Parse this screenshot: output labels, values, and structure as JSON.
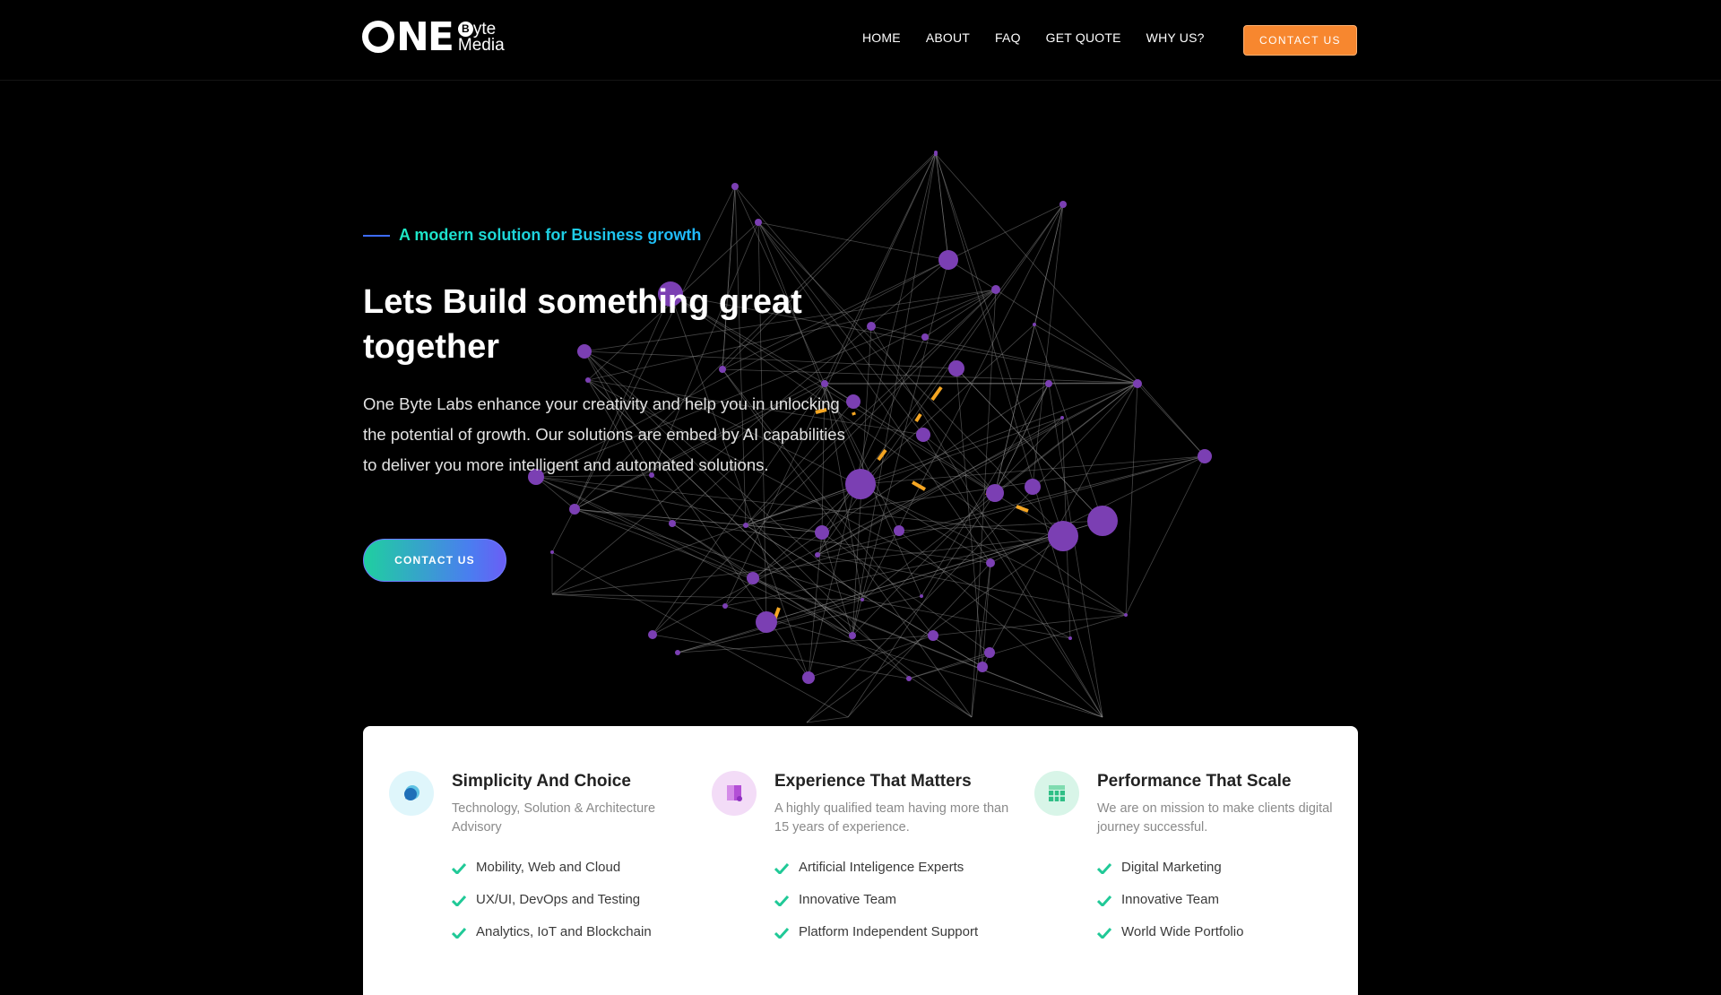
{
  "brand": {
    "logo_main": "ONE",
    "logo_sub_1": "yte",
    "logo_sub_r": "B",
    "logo_sub_2": "Media"
  },
  "nav": {
    "items": [
      "HOME",
      "ABOUT",
      "FAQ",
      "GET QUOTE",
      "WHY US?"
    ],
    "cta_label": "CONTACT US"
  },
  "hero": {
    "tagline": "A modern solution for Business growth",
    "title": "Lets Build something great together",
    "description": "One Byte Labs enhance your creativity and help you in unlocking the potential of growth. Our solutions are embed by AI capabilities to deliver you more intelligent and automated solutions.",
    "cta_label": "CONTACT US"
  },
  "features": [
    {
      "title": "Simplicity And Choice",
      "subtitle": "Technology, Solution & Architecture Advisory",
      "icon": "chat-bubble-icon",
      "items": [
        "Mobility, Web and Cloud",
        "UX/UI, DevOps and Testing",
        "Analytics, IoT and Blockchain"
      ]
    },
    {
      "title": "Experience That Matters",
      "subtitle": "A highly qualified team having more than 15 years of experience.",
      "icon": "book-icon",
      "items": [
        "Artificial Inteligence Experts",
        "Innovative Team",
        "Platform Independent Support"
      ]
    },
    {
      "title": "Performance That Scale",
      "subtitle": "We are on mission to make clients digital journey successful.",
      "icon": "chart-board-icon",
      "items": [
        "Digital Marketing",
        "Innovative Team",
        "World Wide Portfolio"
      ]
    }
  ],
  "colors": {
    "accent_orange": "#f7872f",
    "teal": "#1de9c4",
    "purple_node": "#7a3fb0",
    "check_green": "#20c997"
  }
}
